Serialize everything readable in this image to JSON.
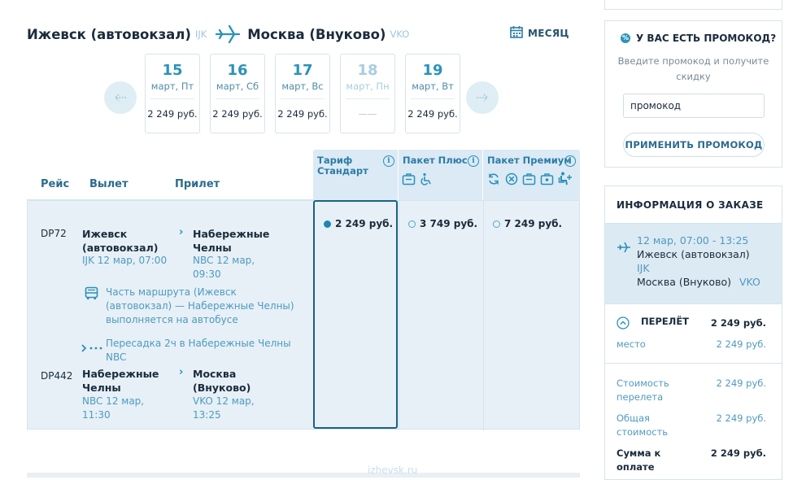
{
  "route": {
    "from_city": "Ижевск (автовокзал)",
    "from_code": "IJK",
    "to_city": "Москва (Внуково)",
    "to_code": "VKO",
    "month_label": "МЕСЯЦ"
  },
  "dates": [
    {
      "day": "15",
      "dow": "март, Пт",
      "price": "2 249 руб."
    },
    {
      "day": "16",
      "dow": "март, Сб",
      "price": "2 249 руб."
    },
    {
      "day": "17",
      "dow": "март, Вс",
      "price": "2 249 руб."
    },
    {
      "day": "18",
      "dow": "март, Пн",
      "price": "——"
    },
    {
      "day": "19",
      "dow": "март, Вт",
      "price": "2 249 руб."
    }
  ],
  "table": {
    "col_flight": "Рейс",
    "col_departure": "Вылет",
    "col_arrival": "Прилет",
    "tariff_standard": "Тариф Стандарт",
    "tariff_plus": "Пакет Плюс",
    "tariff_premium": "Пакет Премиум",
    "info_glyph": "i"
  },
  "flight": {
    "seg1": {
      "number": "DP72",
      "dep_place": "Ижевск (автовокзал)",
      "dep_meta": "IJK 12 мар, 07:00",
      "arr_place": "Набережные Челны",
      "arr_meta": "NBC 12 мар, 09:30"
    },
    "bus_note": "Часть маршрута (Ижевск (автовокзал) — Набережные Челны) выполняется на автобусе",
    "transfer_note": "Пересадка 2ч в Набережные Челны NBC",
    "seg2": {
      "number": "DP442",
      "dep_place": "Набережные Челны",
      "dep_meta": "NBC 12 мар, 11:30",
      "arr_place": "Москва (Внуково)",
      "arr_meta": "VKO 12 мар, 13:25"
    },
    "price_standard": "2 249 руб.",
    "price_plus": "3 749 руб.",
    "price_premium": "7 249 руб."
  },
  "promo": {
    "title": "У ВАС ЕСТЬ ПРОМОКОД?",
    "text": "Введите промокод и получите скидку",
    "input_value": "промокод",
    "button": "ПРИМЕНИТЬ ПРОМОКОД"
  },
  "order": {
    "title": "ИНФОРМАЦИЯ О ЗАКАЗЕ",
    "seg_time": "12 мар, 07:00 - 13:25",
    "seg_from": "Ижевск (автовокзал)",
    "seg_from_code": "IJK",
    "seg_to": "Москва (Внуково)",
    "seg_to_code": "VKO",
    "flight_label": "ПЕРЕЛЁТ",
    "flight_price": "2 249 руб.",
    "seat_label": "место",
    "seat_price": "2 249 руб.",
    "cost_label": "Стоимость перелета",
    "cost_value": "2 249 руб.",
    "total_label": "Общая стоимость",
    "total_value": "2 249 руб.",
    "pay_label": "Сумма к оплате",
    "pay_value": "2 249 руб."
  },
  "watermark": "izhevsk.ru",
  "colors": {
    "accent": "#2a93b9",
    "selected_border": "#1a6286",
    "panel_bg": "#e6f0f6"
  }
}
